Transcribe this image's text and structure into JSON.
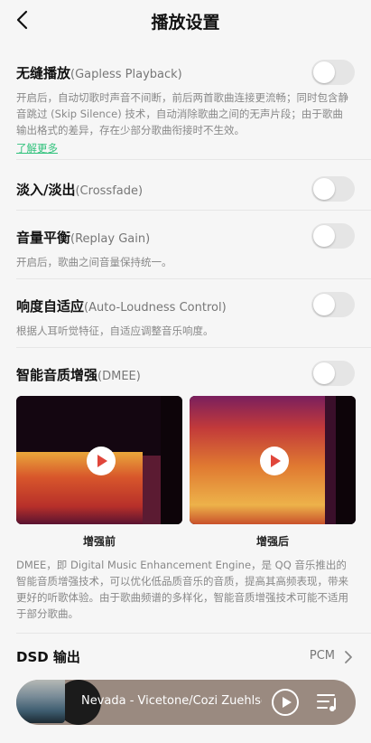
{
  "header": {
    "title": "播放设置"
  },
  "gapless": {
    "title": "无缝播放",
    "title_en": "(Gapless Playback)",
    "desc": "开启后，自动切歌时声音不间断，前后两首歌曲连接更流畅；同时包含静音跳过 (Skip Silence) 技术，自动消除歌曲之间的无声片段；由于歌曲输出格式的差异，存在少部分歌曲衔接时不生效。",
    "link": "了解更多",
    "enabled": false
  },
  "crossfade": {
    "title": "淡入/淡出",
    "title_en": "(Crossfade)",
    "enabled": false
  },
  "replay_gain": {
    "title": "音量平衡",
    "title_en": "(Replay Gain)",
    "desc": "开启后，歌曲之间音量保持统一。",
    "enabled": false
  },
  "loudness": {
    "title": "响度自适应",
    "title_en": "(Auto-Loudness Control)",
    "desc": "根据人耳听觉特征，自适应调整音乐响度。",
    "enabled": false
  },
  "dmee": {
    "title": "智能音质增强",
    "title_en": "(DMEE)",
    "enabled": false,
    "before_label": "增强前",
    "after_label": "增强后",
    "desc": "DMEE，即 Digital Music Enhancement Engine，是 QQ 音乐推出的智能音质增强技术，可以优化低品质音乐的音质，提高其高频表现，带来更好的听歌体验。由于歌曲频谱的多样化，智能音质增强技术可能不适用于部分歌曲。"
  },
  "dsd": {
    "title": "DSD 输出",
    "value": "PCM"
  },
  "player": {
    "now_playing": "Nevada - Vicetone/Cozi Zuehlsdorff"
  },
  "colors": {
    "accent": "#31c27c",
    "toggle_off": "#e5e5e5",
    "play_icon": "#e0463b"
  }
}
